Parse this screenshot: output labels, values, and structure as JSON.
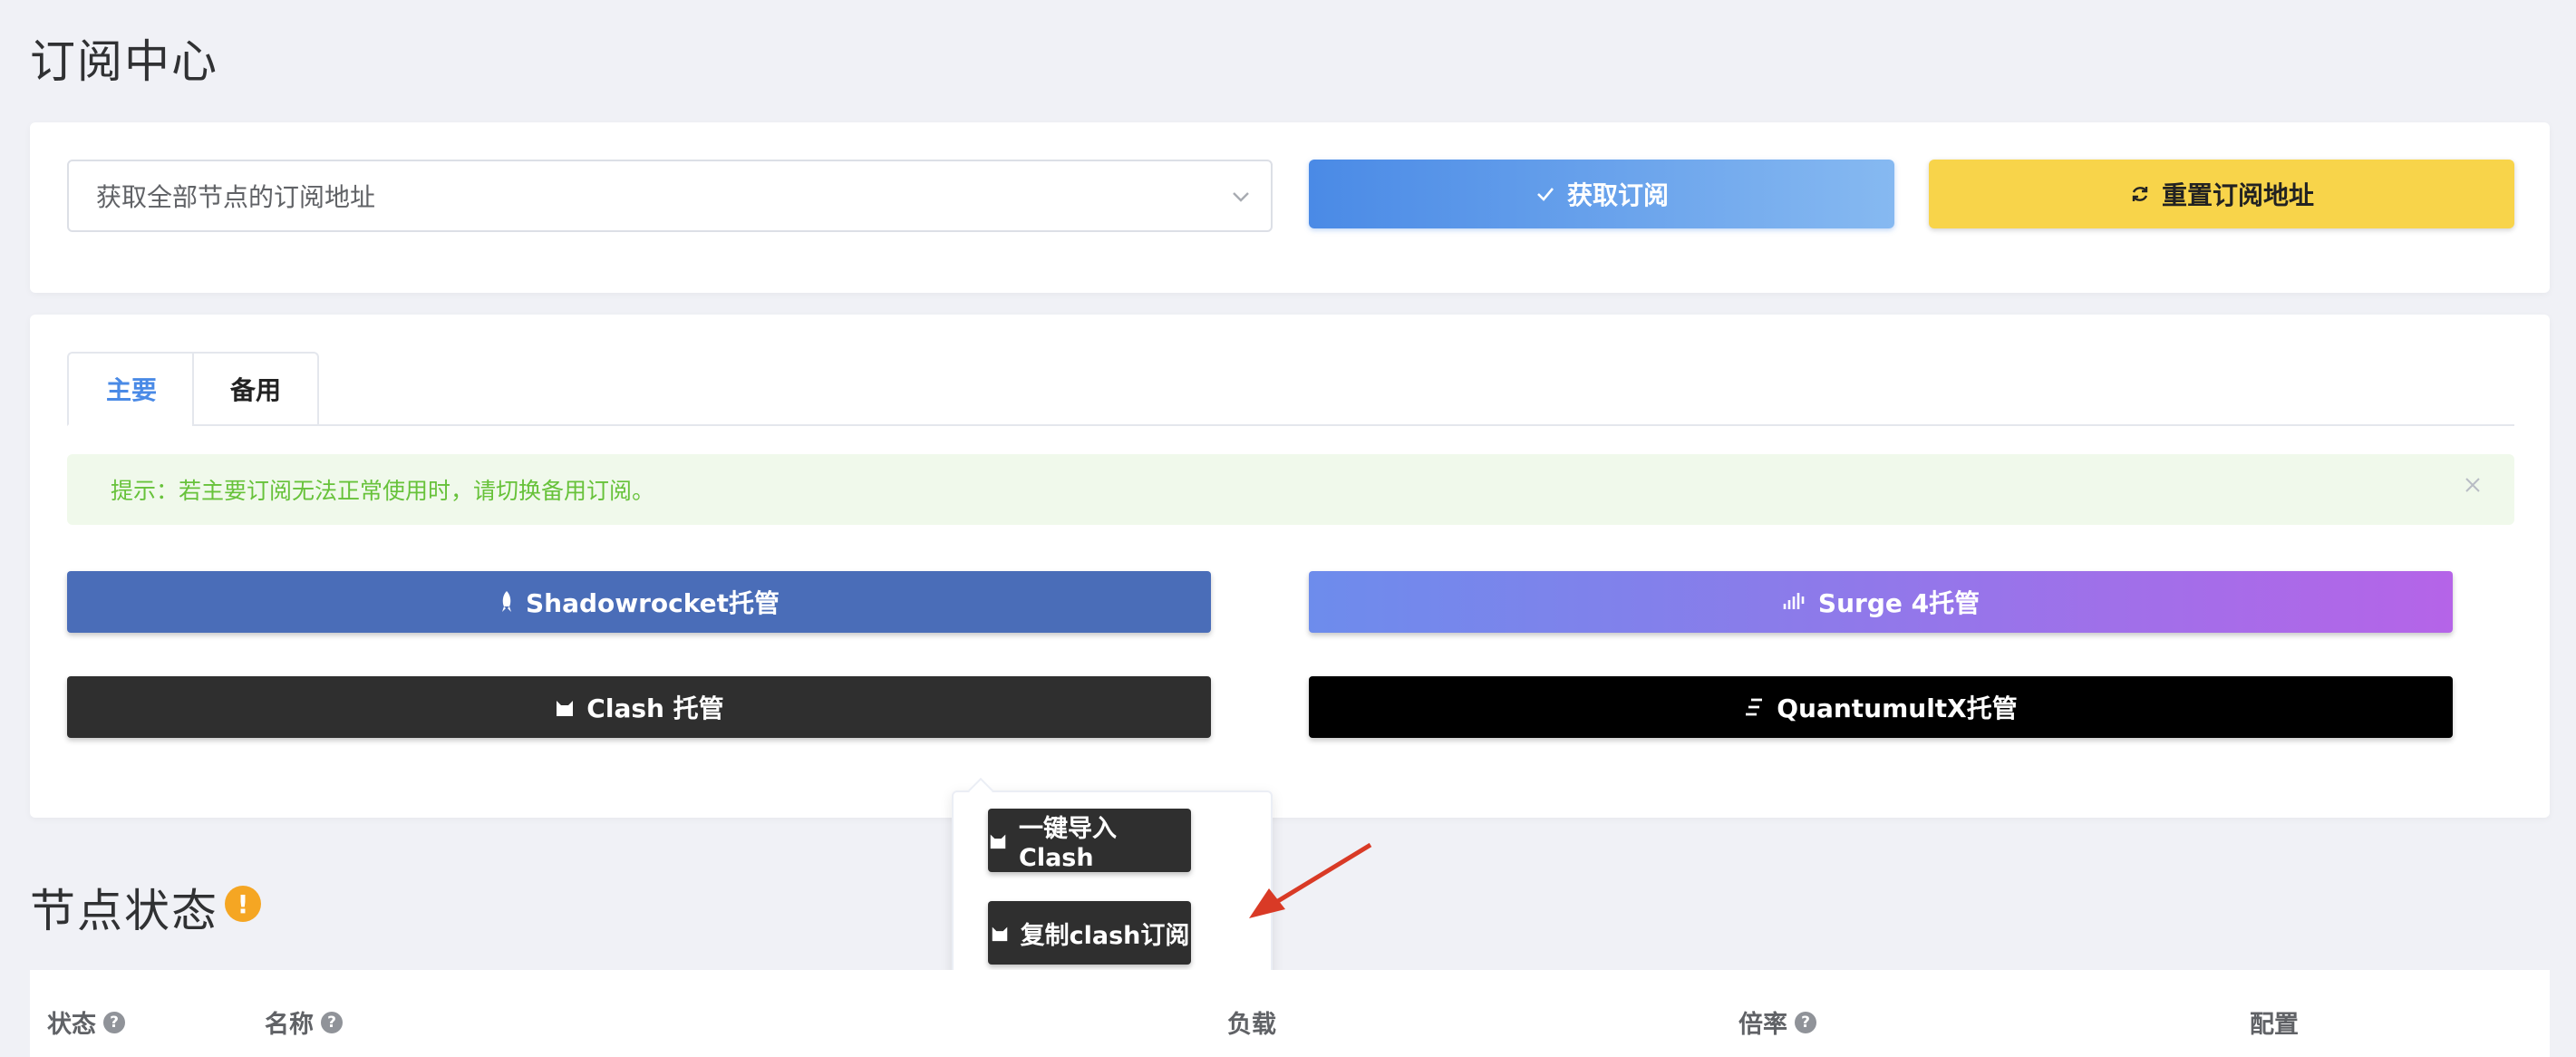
{
  "page_title": "订阅中心",
  "subscription": {
    "select_value": "获取全部节点的订阅地址",
    "get_label": "获取订阅",
    "reset_label": "重置订阅地址"
  },
  "tabs": [
    {
      "label": "主要"
    },
    {
      "label": "备用"
    }
  ],
  "alert": {
    "text": "提示：若主要订阅无法正常使用时，请切换备用订阅。"
  },
  "hosting_buttons": {
    "shadowrocket": "Shadowrocket托管",
    "surge": "Surge 4托管",
    "clash": "Clash 托管",
    "quantumultx": "QuantumultX托管"
  },
  "popover": {
    "import_clash": "一键导入Clash",
    "copy_clash": "复制clash订阅"
  },
  "node_status": {
    "title": "节点状态",
    "warn_symbol": "!",
    "help_symbol": "?",
    "columns": [
      "状态",
      "名称",
      "负载",
      "倍率",
      "配置"
    ]
  },
  "colors": {
    "primary": "#4a8ae6",
    "warning": "#f8d44a",
    "success_text": "#67c23a",
    "annotation_arrow": "#d93a26"
  }
}
